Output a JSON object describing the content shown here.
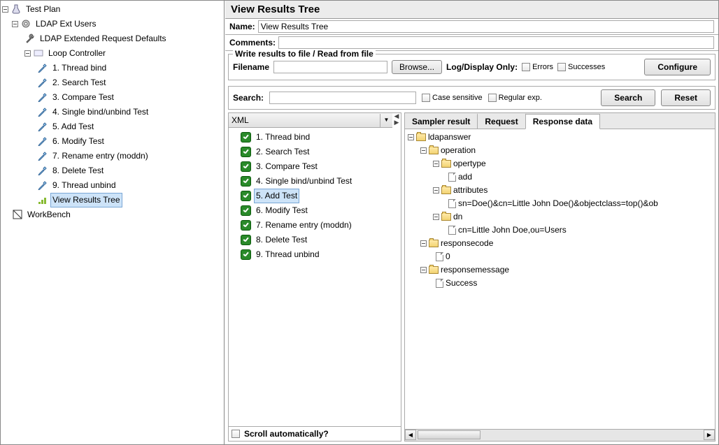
{
  "left_tree": {
    "root": "Test Plan",
    "ldap_ext": "LDAP Ext Users",
    "ldap_defaults": "LDAP Extended Request Defaults",
    "loop": "Loop Controller",
    "samplers": [
      "1. Thread bind",
      "2. Search Test",
      "3. Compare Test",
      "4. Single bind/unbind Test",
      "5. Add Test",
      "6. Modify Test",
      "7. Rename entry (moddn)",
      "8. Delete Test",
      "9. Thread unbind"
    ],
    "view_results": "View Results Tree",
    "workbench": "WorkBench"
  },
  "panel_title": "View Results Tree",
  "name_label": "Name:",
  "name_value": "View Results Tree",
  "comments_label": "Comments:",
  "file_group_title": "Write results to file / Read from file",
  "filename_label": "Filename",
  "browse_btn": "Browse...",
  "log_display_label": "Log/Display Only:",
  "errors_cb": "Errors",
  "successes_cb": "Successes",
  "configure_btn": "Configure",
  "search_label": "Search:",
  "case_sensitive_cb": "Case sensitive",
  "regex_cb": "Regular exp.",
  "search_btn": "Search",
  "reset_btn": "Reset",
  "renderer_value": "XML",
  "results_list": [
    "1. Thread bind",
    "2. Search Test",
    "3. Compare Test",
    "4. Single bind/unbind Test",
    "5. Add Test",
    "6. Modify Test",
    "7. Rename entry (moddn)",
    "8. Delete Test",
    "9. Thread unbind"
  ],
  "results_selected": "5. Add Test",
  "scroll_auto_label": "Scroll automatically?",
  "tabs": {
    "sampler": "Sampler result",
    "request": "Request",
    "response": "Response data"
  },
  "resp_tree": {
    "root": "ldapanswer",
    "operation": "operation",
    "opertype": "opertype",
    "opertype_val": "add",
    "attributes": "attributes",
    "attributes_val": "sn=Doe()&cn=Little John Doe()&objectclass=top()&ob",
    "dn": "dn",
    "dn_val": "cn=Little John Doe,ou=Users",
    "responsecode": "responsecode",
    "responsecode_val": "0",
    "responsemessage": "responsemessage",
    "responsemessage_val": "Success"
  }
}
